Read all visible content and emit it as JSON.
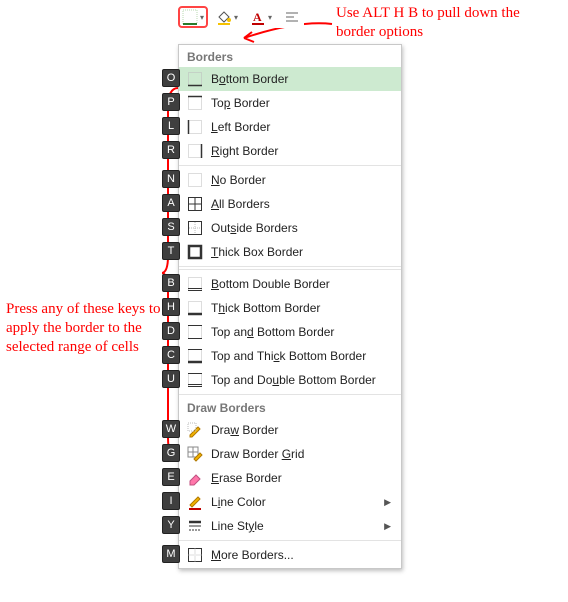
{
  "annotations": {
    "top": "Use ALT H B to pull down the border options",
    "left": "Press any of these keys to apply the border to the selected range of cells"
  },
  "toolbar": {
    "border_btn": "Borders",
    "fill_btn": "Fill Color",
    "font_color_btn": "Font Color",
    "align_btn": "Alignment"
  },
  "menu": {
    "header_borders": "Borders",
    "header_draw": "Draw Borders",
    "items": [
      {
        "key": "O",
        "pre": "B",
        "u": "o",
        "post": "ttom Border",
        "icon": "border-bottom",
        "hover": true
      },
      {
        "key": "P",
        "pre": "To",
        "u": "p",
        "post": " Border",
        "icon": "border-top"
      },
      {
        "key": "L",
        "pre": "",
        "u": "L",
        "post": "eft Border",
        "icon": "border-left"
      },
      {
        "key": "R",
        "pre": "",
        "u": "R",
        "post": "ight Border",
        "icon": "border-right"
      },
      {
        "key": "N",
        "pre": "",
        "u": "N",
        "post": "o Border",
        "icon": "border-none"
      },
      {
        "key": "A",
        "pre": "",
        "u": "A",
        "post": "ll Borders",
        "icon": "border-all"
      },
      {
        "key": "S",
        "pre": "Out",
        "u": "s",
        "post": "ide Borders",
        "icon": "border-outside"
      },
      {
        "key": "T",
        "pre": "",
        "u": "T",
        "post": "hick Box Border",
        "icon": "border-thick"
      },
      {
        "key": "B",
        "pre": "",
        "u": "B",
        "post": "ottom Double Border",
        "icon": "border-dbl-bottom"
      },
      {
        "key": "H",
        "pre": "T",
        "u": "h",
        "post": "ick Bottom Border",
        "icon": "border-thick-bottom"
      },
      {
        "key": "D",
        "pre": "Top an",
        "u": "d",
        "post": " Bottom Border",
        "icon": "border-top-bottom"
      },
      {
        "key": "C",
        "pre": "Top and Thi",
        "u": "c",
        "post": "k Bottom Border",
        "icon": "border-top-thick-bottom"
      },
      {
        "key": "U",
        "pre": "Top and Do",
        "u": "u",
        "post": "ble Bottom Border",
        "icon": "border-top-dbl-bottom"
      },
      {
        "key": "W",
        "pre": "Dra",
        "u": "w",
        "post": " Border",
        "icon": "pencil",
        "section": "draw"
      },
      {
        "key": "G",
        "pre": "Draw Border ",
        "u": "G",
        "post": "rid",
        "icon": "pencil-grid"
      },
      {
        "key": "E",
        "pre": "",
        "u": "E",
        "post": "rase Border",
        "icon": "eraser"
      },
      {
        "key": "I",
        "pre": "L",
        "u": "i",
        "post": "ne Color",
        "icon": "line-color",
        "submenu": true
      },
      {
        "key": "Y",
        "pre": "Line St",
        "u": "y",
        "post": "le",
        "icon": "line-style",
        "submenu": true
      },
      {
        "key": "M",
        "pre": "",
        "u": "M",
        "post": "ore Borders...",
        "icon": "more-borders"
      }
    ]
  }
}
